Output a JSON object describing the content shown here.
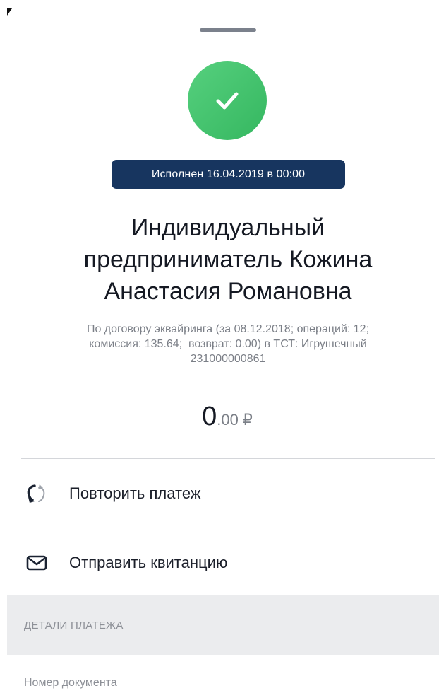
{
  "status": {
    "icon": "check-icon",
    "color": "#3fc26d",
    "badge_text": "Исполнен 16.04.2019 в 00:00",
    "badge_color": "#17355f"
  },
  "recipient": {
    "line1": "Индивидуальный",
    "line2": "предприниматель Кожина",
    "line3": "Анастасия Романовна"
  },
  "description": {
    "line1": "По договору эквайринга (за 08.12.2018; операций: 12;",
    "line2": "комиссия: 135.64;  возврат: 0.00) в ТСТ: Игрушечный",
    "line3": "231000000861"
  },
  "amount": {
    "integer": "0",
    "fraction": ".00 ₽",
    "value": 0.0
  },
  "actions": [
    {
      "label": "Повторить платеж",
      "icon": "repeat-icon"
    },
    {
      "label": "Отправить квитанцию",
      "icon": "envelope-icon"
    }
  ],
  "details": {
    "section_title": "ДЕТАЛИ ПЛАТЕЖА",
    "fields": [
      {
        "label": "Номер документа"
      }
    ]
  }
}
